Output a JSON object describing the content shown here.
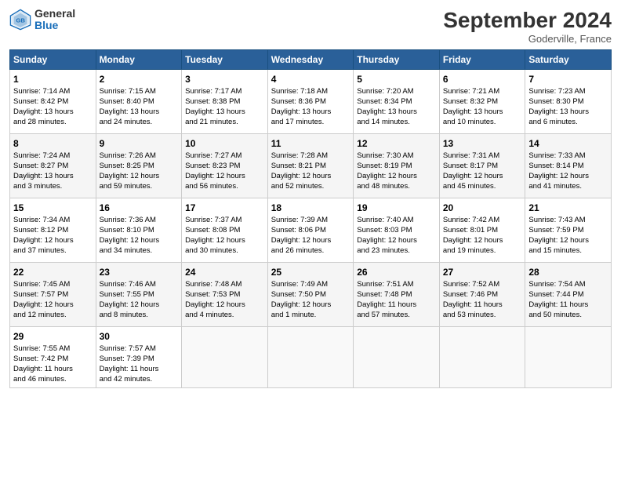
{
  "logo": {
    "general": "General",
    "blue": "Blue"
  },
  "title": "September 2024",
  "location": "Goderville, France",
  "headers": [
    "Sunday",
    "Monday",
    "Tuesday",
    "Wednesday",
    "Thursday",
    "Friday",
    "Saturday"
  ],
  "rows": [
    [
      {
        "day": "1",
        "lines": [
          "Sunrise: 7:14 AM",
          "Sunset: 8:42 PM",
          "Daylight: 13 hours",
          "and 28 minutes."
        ]
      },
      {
        "day": "2",
        "lines": [
          "Sunrise: 7:15 AM",
          "Sunset: 8:40 PM",
          "Daylight: 13 hours",
          "and 24 minutes."
        ]
      },
      {
        "day": "3",
        "lines": [
          "Sunrise: 7:17 AM",
          "Sunset: 8:38 PM",
          "Daylight: 13 hours",
          "and 21 minutes."
        ]
      },
      {
        "day": "4",
        "lines": [
          "Sunrise: 7:18 AM",
          "Sunset: 8:36 PM",
          "Daylight: 13 hours",
          "and 17 minutes."
        ]
      },
      {
        "day": "5",
        "lines": [
          "Sunrise: 7:20 AM",
          "Sunset: 8:34 PM",
          "Daylight: 13 hours",
          "and 14 minutes."
        ]
      },
      {
        "day": "6",
        "lines": [
          "Sunrise: 7:21 AM",
          "Sunset: 8:32 PM",
          "Daylight: 13 hours",
          "and 10 minutes."
        ]
      },
      {
        "day": "7",
        "lines": [
          "Sunrise: 7:23 AM",
          "Sunset: 8:30 PM",
          "Daylight: 13 hours",
          "and 6 minutes."
        ]
      }
    ],
    [
      {
        "day": "8",
        "lines": [
          "Sunrise: 7:24 AM",
          "Sunset: 8:27 PM",
          "Daylight: 13 hours",
          "and 3 minutes."
        ]
      },
      {
        "day": "9",
        "lines": [
          "Sunrise: 7:26 AM",
          "Sunset: 8:25 PM",
          "Daylight: 12 hours",
          "and 59 minutes."
        ]
      },
      {
        "day": "10",
        "lines": [
          "Sunrise: 7:27 AM",
          "Sunset: 8:23 PM",
          "Daylight: 12 hours",
          "and 56 minutes."
        ]
      },
      {
        "day": "11",
        "lines": [
          "Sunrise: 7:28 AM",
          "Sunset: 8:21 PM",
          "Daylight: 12 hours",
          "and 52 minutes."
        ]
      },
      {
        "day": "12",
        "lines": [
          "Sunrise: 7:30 AM",
          "Sunset: 8:19 PM",
          "Daylight: 12 hours",
          "and 48 minutes."
        ]
      },
      {
        "day": "13",
        "lines": [
          "Sunrise: 7:31 AM",
          "Sunset: 8:17 PM",
          "Daylight: 12 hours",
          "and 45 minutes."
        ]
      },
      {
        "day": "14",
        "lines": [
          "Sunrise: 7:33 AM",
          "Sunset: 8:14 PM",
          "Daylight: 12 hours",
          "and 41 minutes."
        ]
      }
    ],
    [
      {
        "day": "15",
        "lines": [
          "Sunrise: 7:34 AM",
          "Sunset: 8:12 PM",
          "Daylight: 12 hours",
          "and 37 minutes."
        ]
      },
      {
        "day": "16",
        "lines": [
          "Sunrise: 7:36 AM",
          "Sunset: 8:10 PM",
          "Daylight: 12 hours",
          "and 34 minutes."
        ]
      },
      {
        "day": "17",
        "lines": [
          "Sunrise: 7:37 AM",
          "Sunset: 8:08 PM",
          "Daylight: 12 hours",
          "and 30 minutes."
        ]
      },
      {
        "day": "18",
        "lines": [
          "Sunrise: 7:39 AM",
          "Sunset: 8:06 PM",
          "Daylight: 12 hours",
          "and 26 minutes."
        ]
      },
      {
        "day": "19",
        "lines": [
          "Sunrise: 7:40 AM",
          "Sunset: 8:03 PM",
          "Daylight: 12 hours",
          "and 23 minutes."
        ]
      },
      {
        "day": "20",
        "lines": [
          "Sunrise: 7:42 AM",
          "Sunset: 8:01 PM",
          "Daylight: 12 hours",
          "and 19 minutes."
        ]
      },
      {
        "day": "21",
        "lines": [
          "Sunrise: 7:43 AM",
          "Sunset: 7:59 PM",
          "Daylight: 12 hours",
          "and 15 minutes."
        ]
      }
    ],
    [
      {
        "day": "22",
        "lines": [
          "Sunrise: 7:45 AM",
          "Sunset: 7:57 PM",
          "Daylight: 12 hours",
          "and 12 minutes."
        ]
      },
      {
        "day": "23",
        "lines": [
          "Sunrise: 7:46 AM",
          "Sunset: 7:55 PM",
          "Daylight: 12 hours",
          "and 8 minutes."
        ]
      },
      {
        "day": "24",
        "lines": [
          "Sunrise: 7:48 AM",
          "Sunset: 7:53 PM",
          "Daylight: 12 hours",
          "and 4 minutes."
        ]
      },
      {
        "day": "25",
        "lines": [
          "Sunrise: 7:49 AM",
          "Sunset: 7:50 PM",
          "Daylight: 12 hours",
          "and 1 minute."
        ]
      },
      {
        "day": "26",
        "lines": [
          "Sunrise: 7:51 AM",
          "Sunset: 7:48 PM",
          "Daylight: 11 hours",
          "and 57 minutes."
        ]
      },
      {
        "day": "27",
        "lines": [
          "Sunrise: 7:52 AM",
          "Sunset: 7:46 PM",
          "Daylight: 11 hours",
          "and 53 minutes."
        ]
      },
      {
        "day": "28",
        "lines": [
          "Sunrise: 7:54 AM",
          "Sunset: 7:44 PM",
          "Daylight: 11 hours",
          "and 50 minutes."
        ]
      }
    ],
    [
      {
        "day": "29",
        "lines": [
          "Sunrise: 7:55 AM",
          "Sunset: 7:42 PM",
          "Daylight: 11 hours",
          "and 46 minutes."
        ]
      },
      {
        "day": "30",
        "lines": [
          "Sunrise: 7:57 AM",
          "Sunset: 7:39 PM",
          "Daylight: 11 hours",
          "and 42 minutes."
        ]
      },
      {
        "day": "",
        "lines": []
      },
      {
        "day": "",
        "lines": []
      },
      {
        "day": "",
        "lines": []
      },
      {
        "day": "",
        "lines": []
      },
      {
        "day": "",
        "lines": []
      }
    ]
  ]
}
